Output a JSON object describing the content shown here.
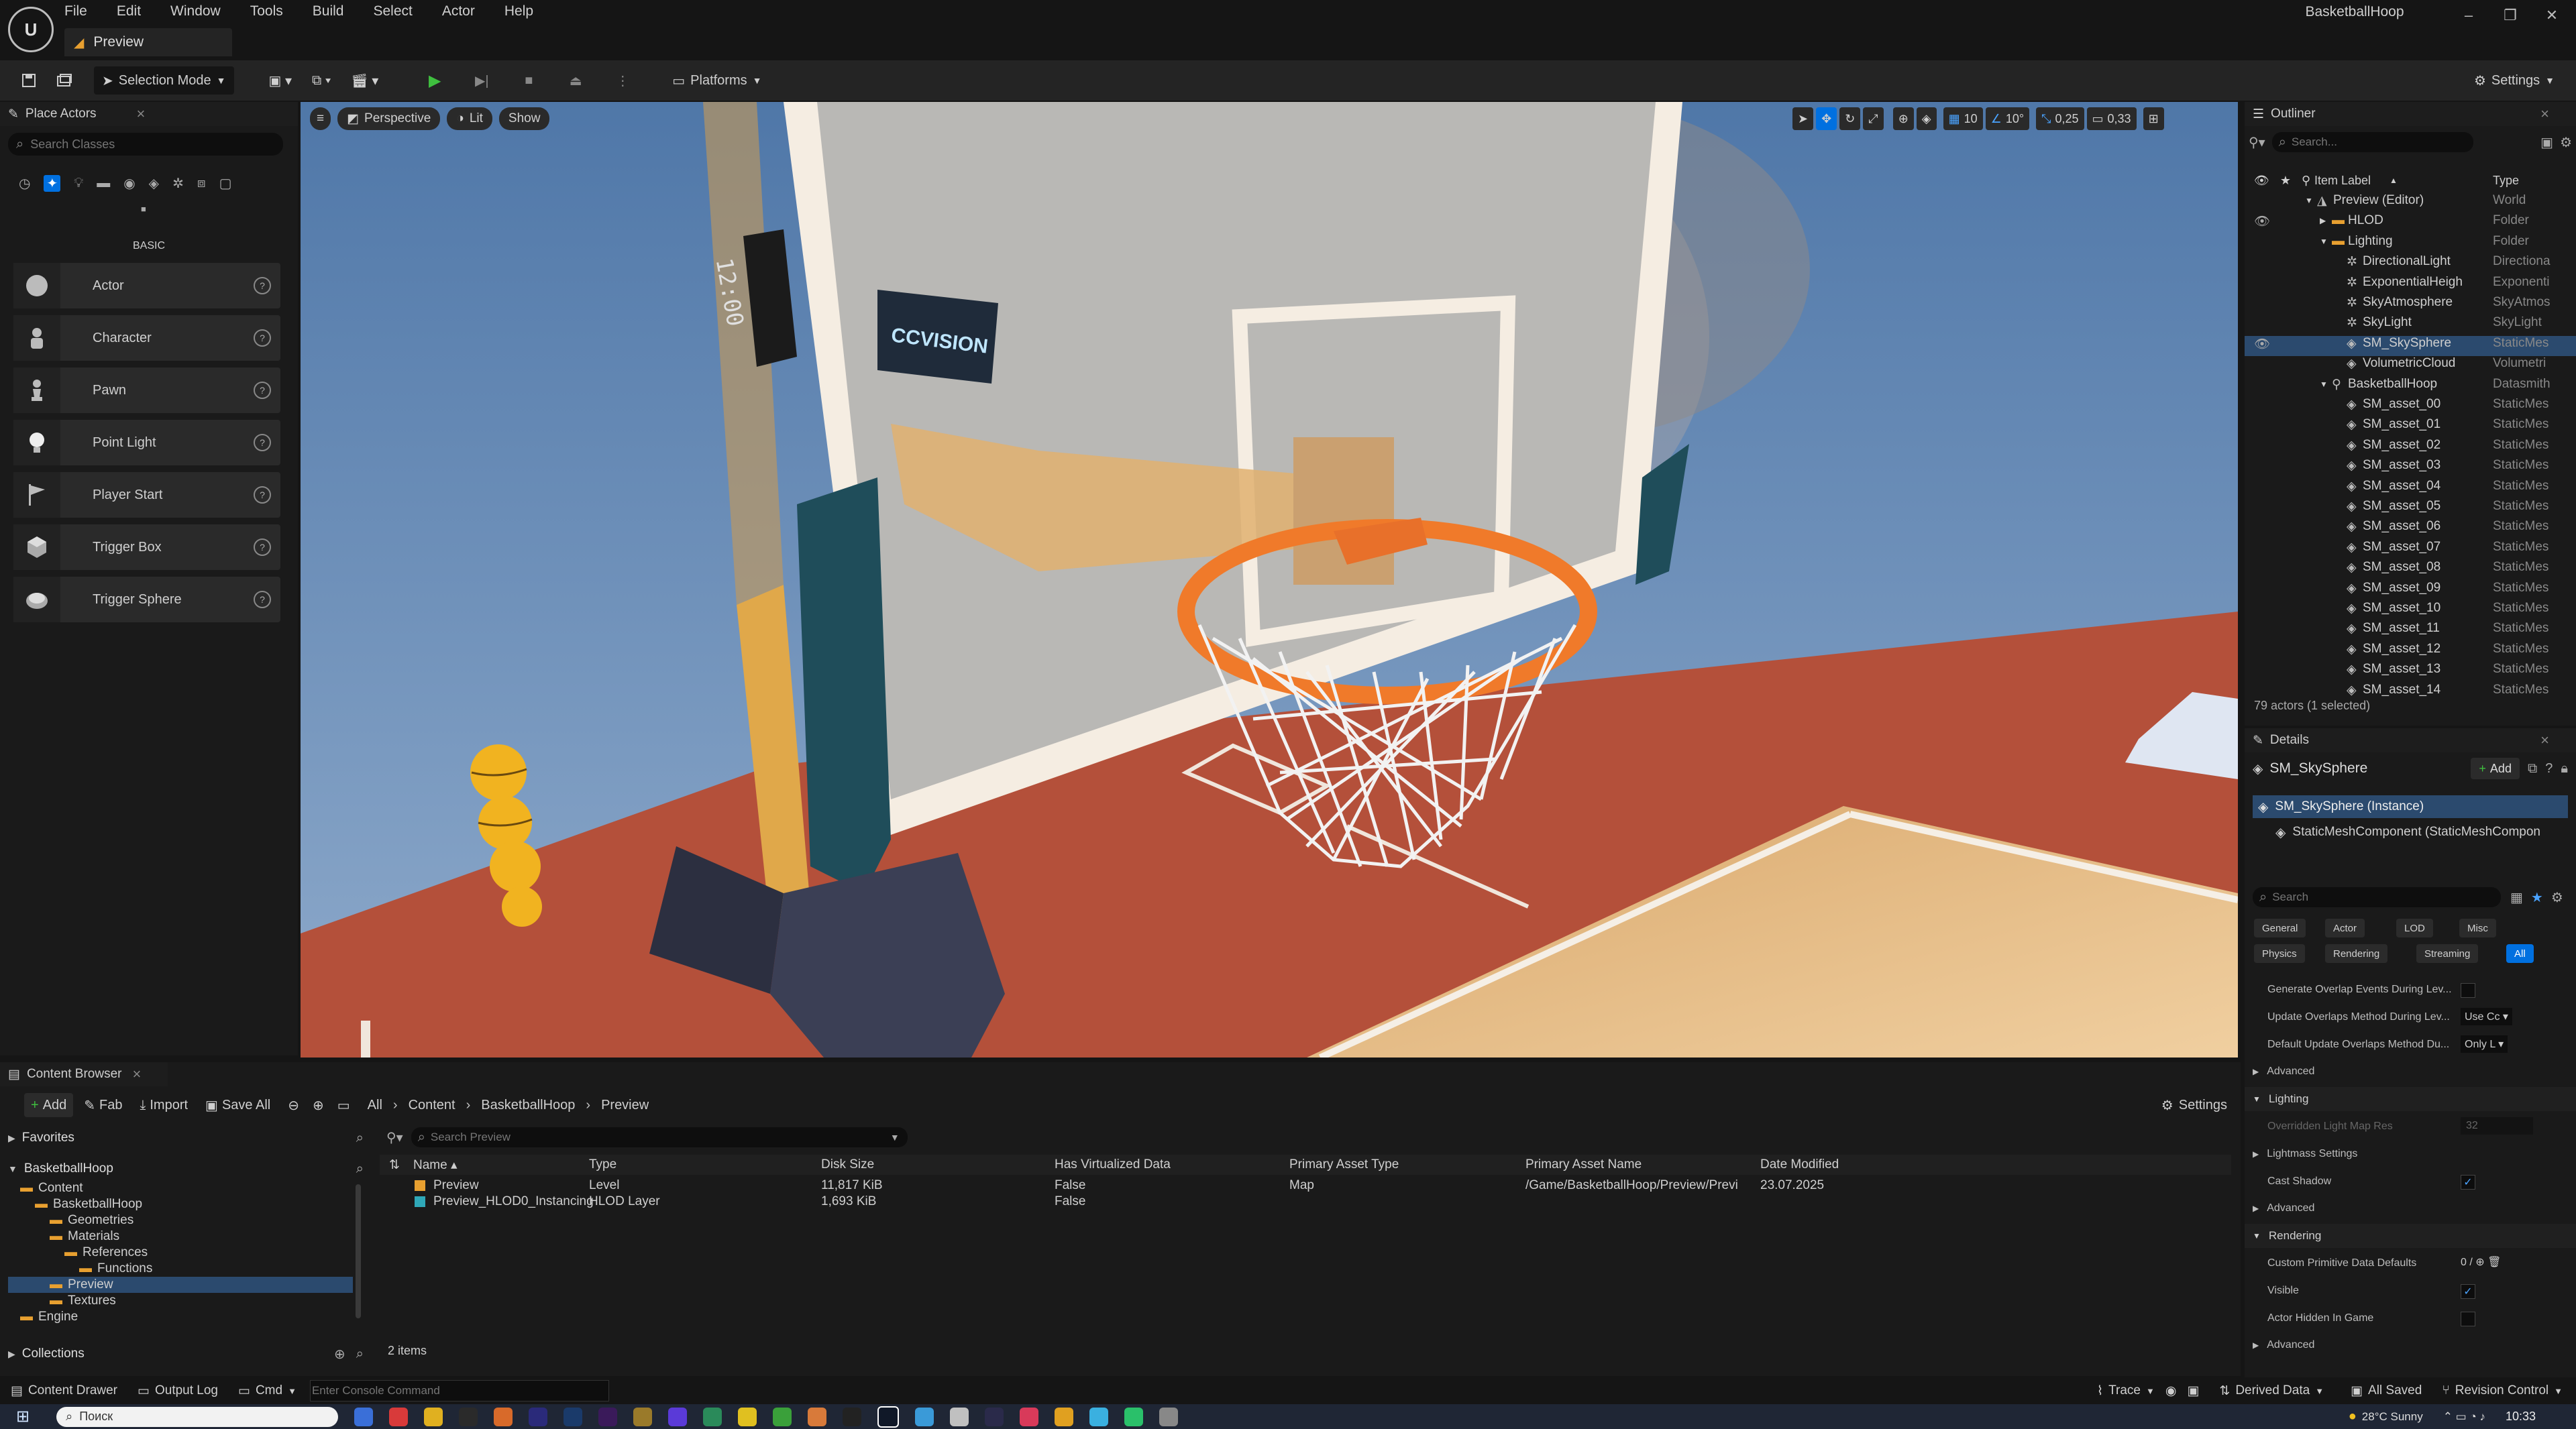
{
  "window": {
    "project_name": "BasketballHoop",
    "level_tab": "Preview"
  },
  "menu": [
    "File",
    "Edit",
    "Window",
    "Tools",
    "Build",
    "Select",
    "Actor",
    "Help"
  ],
  "toolbar": {
    "selection_mode": "Selection Mode",
    "platforms": "Platforms",
    "settings": "Settings"
  },
  "place_actors": {
    "title": "Place Actors",
    "search_placeholder": "Search Classes",
    "category": "BASIC",
    "items": [
      "Actor",
      "Character",
      "Pawn",
      "Point Light",
      "Player Start",
      "Trigger Box",
      "Trigger Sphere"
    ]
  },
  "viewport": {
    "perspective": "Perspective",
    "lit": "Lit",
    "show": "Show",
    "grid_snap": "10",
    "rotation_snap": "10°",
    "scale_snap": "0,25",
    "camera_speed": "0,33",
    "scene": {
      "scoreboard_text": "12:00",
      "sign_text": "CCVISION",
      "sky_color": "#6c90b8",
      "floor_color": "#b4503a",
      "wood_color": "#e2b47c",
      "rim_color": "#f07a2a"
    }
  },
  "outliner": {
    "title": "Outliner",
    "search_placeholder": "Search...",
    "col_label": "Item Label",
    "col_type": "Type",
    "rows": [
      {
        "label": "Preview (Editor)",
        "type": "World",
        "depth": 0,
        "kind": "world"
      },
      {
        "label": "HLOD",
        "type": "Folder",
        "depth": 1,
        "kind": "folder"
      },
      {
        "label": "Lighting",
        "type": "Folder",
        "depth": 1,
        "kind": "folder"
      },
      {
        "label": "DirectionalLight",
        "type": "Directiona",
        "depth": 2,
        "kind": "light"
      },
      {
        "label": "ExponentialHeigh",
        "type": "Exponenti",
        "depth": 2,
        "kind": "light"
      },
      {
        "label": "SkyAtmosphere",
        "type": "SkyAtmos",
        "depth": 2,
        "kind": "light"
      },
      {
        "label": "SkyLight",
        "type": "SkyLight",
        "depth": 2,
        "kind": "light"
      },
      {
        "label": "SM_SkySphere",
        "type": "StaticMes",
        "depth": 2,
        "kind": "mesh",
        "selected": true
      },
      {
        "label": "VolumetricCloud",
        "type": "Volumetri",
        "depth": 2,
        "kind": "mesh"
      },
      {
        "label": "BasketballHoop",
        "type": "Datasmith",
        "depth": 1,
        "kind": "actor"
      },
      {
        "label": "SM_asset_00",
        "type": "StaticMes",
        "depth": 2,
        "kind": "mesh"
      },
      {
        "label": "SM_asset_01",
        "type": "StaticMes",
        "depth": 2,
        "kind": "mesh"
      },
      {
        "label": "SM_asset_02",
        "type": "StaticMes",
        "depth": 2,
        "kind": "mesh"
      },
      {
        "label": "SM_asset_03",
        "type": "StaticMes",
        "depth": 2,
        "kind": "mesh"
      },
      {
        "label": "SM_asset_04",
        "type": "StaticMes",
        "depth": 2,
        "kind": "mesh"
      },
      {
        "label": "SM_asset_05",
        "type": "StaticMes",
        "depth": 2,
        "kind": "mesh"
      },
      {
        "label": "SM_asset_06",
        "type": "StaticMes",
        "depth": 2,
        "kind": "mesh"
      },
      {
        "label": "SM_asset_07",
        "type": "StaticMes",
        "depth": 2,
        "kind": "mesh"
      },
      {
        "label": "SM_asset_08",
        "type": "StaticMes",
        "depth": 2,
        "kind": "mesh"
      },
      {
        "label": "SM_asset_09",
        "type": "StaticMes",
        "depth": 2,
        "kind": "mesh"
      },
      {
        "label": "SM_asset_10",
        "type": "StaticMes",
        "depth": 2,
        "kind": "mesh"
      },
      {
        "label": "SM_asset_11",
        "type": "StaticMes",
        "depth": 2,
        "kind": "mesh"
      },
      {
        "label": "SM_asset_12",
        "type": "StaticMes",
        "depth": 2,
        "kind": "mesh"
      },
      {
        "label": "SM_asset_13",
        "type": "StaticMes",
        "depth": 2,
        "kind": "mesh"
      },
      {
        "label": "SM_asset_14",
        "type": "StaticMes",
        "depth": 2,
        "kind": "mesh"
      }
    ],
    "footer": "79 actors (1 selected)"
  },
  "details": {
    "title": "Details",
    "object_name": "SM_SkySphere",
    "add_label": "Add",
    "instance_label": "SM_SkySphere (Instance)",
    "component_label": "StaticMeshComponent (StaticMeshCompon",
    "search_placeholder": "Search",
    "filters_row1": [
      "General",
      "Actor",
      "LOD",
      "Misc"
    ],
    "filters_row2": [
      "Physics",
      "Rendering",
      "Streaming",
      "All"
    ],
    "rows": [
      {
        "kind": "prop",
        "label": "Generate Overlap Events During Lev...",
        "control": "checkbox",
        "checked": false
      },
      {
        "kind": "prop",
        "label": "Update Overlaps Method During Lev...",
        "control": "dropdown",
        "value": "Use Cc"
      },
      {
        "kind": "prop",
        "label": "Default Update Overlaps Method Du...",
        "control": "dropdown",
        "value": "Only L"
      },
      {
        "kind": "sub",
        "label": "Advanced"
      },
      {
        "kind": "cat",
        "label": "Lighting"
      },
      {
        "kind": "prop",
        "label": "Overridden Light Map Res",
        "control": "number",
        "value": "32",
        "disabled": true
      },
      {
        "kind": "sub",
        "label": "Lightmass Settings"
      },
      {
        "kind": "prop",
        "label": "Cast Shadow",
        "control": "checkbox",
        "checked": true
      },
      {
        "kind": "sub",
        "label": "Advanced"
      },
      {
        "kind": "cat",
        "label": "Rendering"
      },
      {
        "kind": "prop",
        "label": "Custom Primitive Data Defaults",
        "control": "array",
        "value": "0 /"
      },
      {
        "kind": "prop",
        "label": "Visible",
        "control": "checkbox",
        "checked": true
      },
      {
        "kind": "prop",
        "label": "Actor Hidden In Game",
        "control": "checkbox",
        "checked": false
      },
      {
        "kind": "sub",
        "label": "Advanced"
      }
    ]
  },
  "content_browser": {
    "title": "Content Browser",
    "add": "Add",
    "fab": "Fab",
    "import": "Import",
    "save_all": "Save All",
    "breadcrumb": [
      "All",
      "Content",
      "BasketballHoop",
      "Preview"
    ],
    "settings": "Settings",
    "favorites": "Favorites",
    "root": "BasketballHoop",
    "collections": "Collections",
    "search_placeholder": "Search Preview",
    "tree": [
      {
        "label": "Content",
        "depth": 0
      },
      {
        "label": "BasketballHoop",
        "depth": 1
      },
      {
        "label": "Geometries",
        "depth": 2
      },
      {
        "label": "Materials",
        "depth": 2
      },
      {
        "label": "References",
        "depth": 3
      },
      {
        "label": "Functions",
        "depth": 4
      },
      {
        "label": "Preview",
        "depth": 2,
        "selected": true
      },
      {
        "label": "Textures",
        "depth": 2
      },
      {
        "label": "Engine",
        "depth": 0
      }
    ],
    "columns": [
      "Name",
      "Type",
      "Disk Size",
      "Has Virtualized Data",
      "Primary Asset Type",
      "Primary Asset Name",
      "Date Modified"
    ],
    "files": [
      {
        "name": "Preview",
        "type": "Level",
        "size": "11,817 KiB",
        "virtualized": "False",
        "asset_type": "Map",
        "asset_name": "/Game/BasketballHoop/Preview/Previ",
        "date": "23.07.2025",
        "color": "#e8a030"
      },
      {
        "name": "Preview_HLOD0_Instancing",
        "type": "HLOD Layer",
        "size": "1,693 KiB",
        "virtualized": "False",
        "asset_type": "",
        "asset_name": "",
        "date": "",
        "color": "#2fa8b8"
      }
    ],
    "item_count": "2 items"
  },
  "statusbar": {
    "content_drawer": "Content Drawer",
    "output_log": "Output Log",
    "cmd": "Cmd",
    "console_placeholder": "Enter Console Command",
    "trace": "Trace",
    "derived_data": "Derived Data",
    "all_saved": "All Saved",
    "revision_control": "Revision Control"
  },
  "taskbar": {
    "search": "Поиск",
    "clock": "10:33",
    "weather": "28°C Sunny"
  },
  "colors": {
    "accent": "#0070e0",
    "panel": "#1a1a1a",
    "selected_row": "#2b4a6e"
  }
}
